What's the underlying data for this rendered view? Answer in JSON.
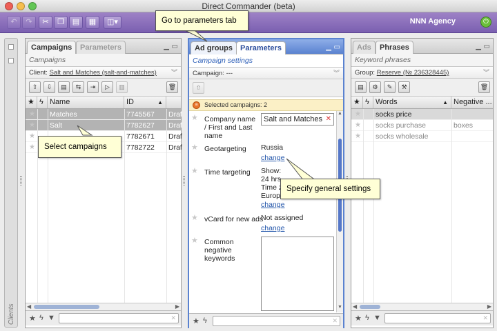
{
  "window": {
    "title": "Direct Commander (beta)"
  },
  "toolbar": {
    "agency": "NNN Agency",
    "buttons": [
      {
        "icon": "undo-icon",
        "glyph": "↶"
      },
      {
        "icon": "redo-icon",
        "glyph": "↷"
      },
      {
        "icon": "cut-icon",
        "glyph": "✂"
      },
      {
        "icon": "copy-icon",
        "glyph": "❐"
      },
      {
        "icon": "paste-icon",
        "glyph": "▤"
      },
      {
        "icon": "grid-icon",
        "glyph": "▦"
      },
      {
        "icon": "view-menu-icon",
        "glyph": "◫▾"
      }
    ]
  },
  "sidebar": {
    "label": "Clients"
  },
  "left_panel": {
    "tabs": [
      "Campaigns",
      "Parameters"
    ],
    "subtitle": "Campaigns",
    "client_label": "Client:",
    "client_value": "Salt and Matches (salt-and-matches)",
    "columns": [
      "Name",
      "ID"
    ],
    "rows": [
      {
        "name": "Matches",
        "id": "7745567",
        "status": "Draft",
        "selected": true
      },
      {
        "name": "Salt",
        "id": "7782627",
        "status": "Draft",
        "selected": true
      },
      {
        "name": "",
        "id": "7782671",
        "status": "Draft",
        "selected": false
      },
      {
        "name": "",
        "id": "7782722",
        "status": "Draft",
        "selected": false
      }
    ],
    "callout": "Select campaigns"
  },
  "mid_panel": {
    "tabs": [
      "Ad groups",
      "Parameters"
    ],
    "subtitle": "Campaign settings",
    "campaign_label": "Campaign:",
    "campaign_value": "---",
    "selected_note": "Selected campaigns: 2",
    "company_label": "Company name / First and Last name",
    "company_value": "Salt and Matches",
    "geo_label": "Geotargeting",
    "geo_value": "Russia",
    "change": "change",
    "time_label": "Time targeting",
    "time_lines": [
      "Show:",
      "24 hrs",
      "Time zo",
      "Europe"
    ],
    "vcard_label": "vCard for new ads",
    "vcard_value": "Not assigned",
    "negative_label": "Common negative keywords",
    "callout_tab": "Go to parameters tab",
    "callout_settings": "Specify general settings"
  },
  "right_panel": {
    "tabs": [
      "Ads",
      "Phrases"
    ],
    "subtitle": "Keyword phrases",
    "group_label": "Group:",
    "group_value": "Reserve (№ 236328445)",
    "columns": [
      "Words",
      "Negative ..."
    ],
    "rows": [
      {
        "words": "socks price",
        "negative": "",
        "selected": true
      },
      {
        "words": "socks purchase",
        "negative": "boxes",
        "selected": false
      },
      {
        "words": "socks wholesale",
        "negative": "",
        "selected": false
      }
    ]
  }
}
